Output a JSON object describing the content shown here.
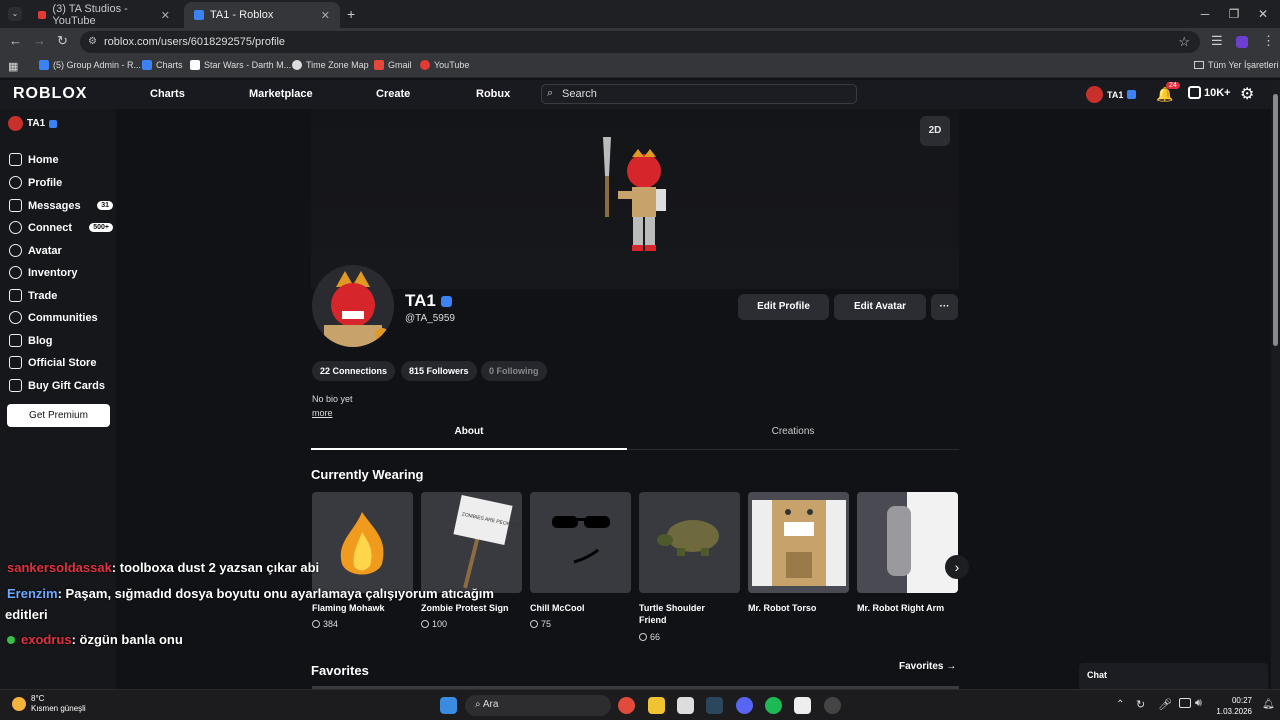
{
  "browser": {
    "tabs": [
      {
        "title": "(3) TA Studios - YouTube"
      },
      {
        "title": "TA1 - Roblox"
      }
    ],
    "url": "roblox.com/users/6018292575/profile",
    "bookmarks": [
      "(5) Group Admin - R...",
      "Charts",
      "Star Wars - Darth M...",
      "Time Zone Map",
      "Gmail",
      "YouTube"
    ],
    "all_bookmarks": "Tüm Yer İşaretleri"
  },
  "header": {
    "logo": "ROBLOX",
    "nav": [
      "Charts",
      "Marketplace",
      "Create",
      "Robux"
    ],
    "search_placeholder": "Search",
    "username": "TA1",
    "notifications": "24",
    "robux": "10K+"
  },
  "sidebar": {
    "user": "TA1",
    "items": [
      {
        "label": "Home",
        "icon": "home-icon",
        "badge": ""
      },
      {
        "label": "Profile",
        "icon": "profile-icon",
        "badge": ""
      },
      {
        "label": "Messages",
        "icon": "messages-icon",
        "badge": "31"
      },
      {
        "label": "Connect",
        "icon": "connect-icon",
        "badge": "500+"
      },
      {
        "label": "Avatar",
        "icon": "avatar-icon",
        "badge": ""
      },
      {
        "label": "Inventory",
        "icon": "inventory-icon",
        "badge": ""
      },
      {
        "label": "Trade",
        "icon": "trade-icon",
        "badge": ""
      },
      {
        "label": "Communities",
        "icon": "communities-icon",
        "badge": ""
      },
      {
        "label": "Blog",
        "icon": "blog-icon",
        "badge": ""
      },
      {
        "label": "Official Store",
        "icon": "store-icon",
        "badge": ""
      },
      {
        "label": "Buy Gift Cards",
        "icon": "giftcard-icon",
        "badge": ""
      }
    ],
    "premium": "Get Premium"
  },
  "profile": {
    "toggle_2d": "2D",
    "display_name": "TA1",
    "handle": "@TA_5959",
    "edit_profile": "Edit Profile",
    "edit_avatar": "Edit Avatar",
    "more_menu": "···",
    "connections": "22 Connections",
    "followers": "815 Followers",
    "following": "0 Following",
    "bio": "No bio yet",
    "more_link": "more",
    "tabs": [
      "About",
      "Creations"
    ]
  },
  "wearing": {
    "title": "Currently Wearing",
    "items": [
      {
        "name": "Flaming Mohawk",
        "price": "384"
      },
      {
        "name": "Zombie Protest Sign",
        "price": "100"
      },
      {
        "name": "Chill McCool",
        "price": "75"
      },
      {
        "name": "Turtle Shoulder Friend",
        "price": "66"
      },
      {
        "name": "Mr. Robot Torso",
        "price": ""
      },
      {
        "name": "Mr. Robot Right Arm",
        "price": ""
      }
    ],
    "sign_text": "ZOMBIES ARE PEOPLE TOO!"
  },
  "favorites": {
    "title": "Favorites",
    "link": "Favorites"
  },
  "chat_overlay": [
    {
      "user": "sankersoldassak",
      "text": ": toolboxa dust 2 yazsan çıkar abi",
      "color": "#e0313f"
    },
    {
      "user": "Erenzim",
      "text": ": Paşam, sığmadıd dosya boyutu onu ayarlamaya çalışıyorum atıcağım",
      "color": "#6fa8ff",
      "text2": "editleri"
    },
    {
      "user": "exodrus",
      "text": ": özgün banla onu",
      "color": "#e0313f"
    }
  ],
  "chat_widget": "Chat",
  "taskbar": {
    "weather_temp": "8°C",
    "weather_desc": "Kısmen güneşli",
    "search": "Ara",
    "time": "00:27",
    "date": "1.03.2026"
  }
}
